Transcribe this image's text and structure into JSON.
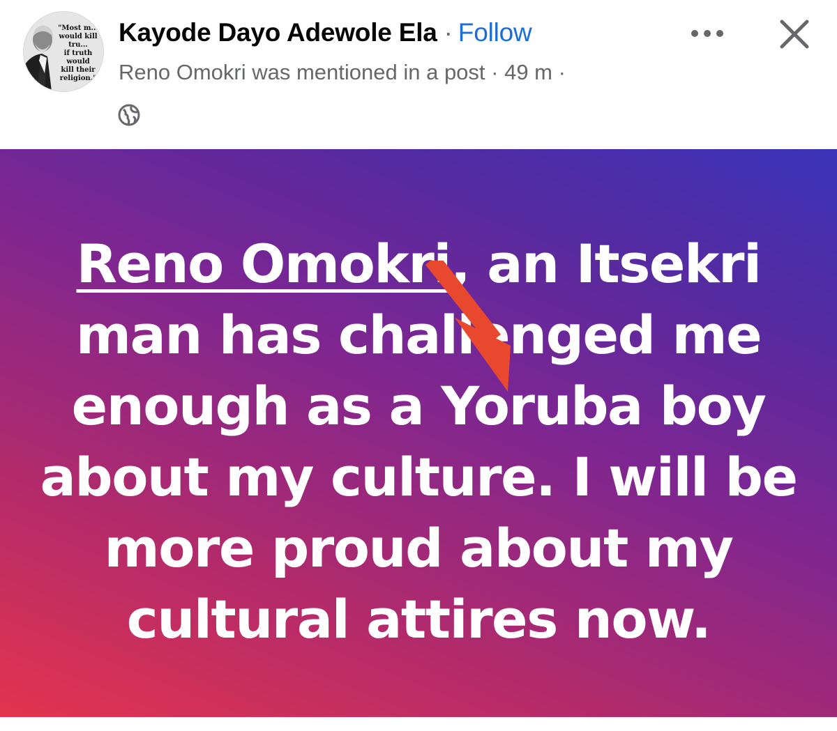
{
  "header": {
    "avatar_quote": "\"Most m...\nwould kill tru...\nif truth would\nkill their\nreligion.\"",
    "author_name": "Kayode Dayo Adewole Ela",
    "separator": "·",
    "follow_label": "Follow",
    "subtitle": "Reno Omokri was mentioned in a post · 49 m ·",
    "audience_icon": "globe-icon",
    "more_icon": "more-options-icon",
    "close_icon": "close-icon"
  },
  "post": {
    "mention": "Reno Omokri",
    "text_after_mention": ", an Itsekri man has challenged me enough as a Yoruba boy about my culture. I will be more proud about my cultural attires now.",
    "annotation_icon": "red-arrow-icon",
    "background_colors": [
      "#e3344e",
      "#7b2693",
      "#3a32b8"
    ],
    "arrow_color": "#e8492e"
  },
  "colors": {
    "link": "#1b6dd6",
    "secondary_text": "#65676b",
    "primary_text": "#050505"
  }
}
